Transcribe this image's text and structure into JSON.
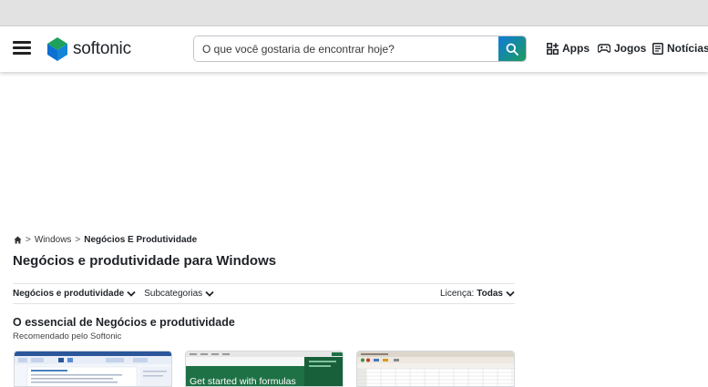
{
  "header": {
    "logo_text": "softonic",
    "search_placeholder": "O que você gostaria de encontrar hoje?",
    "nav": {
      "apps": "Apps",
      "games": "Jogos",
      "news": "Notícias"
    }
  },
  "breadcrumb": {
    "sep1": ">",
    "windows": "Windows",
    "sep2": ">",
    "current": "Negócios E Produtividade"
  },
  "page_title": "Negócios e produtividade para Windows",
  "filters": {
    "category": "Negócios e produtividade",
    "subcategories": "Subcategorias",
    "license_label": "Licença:",
    "license_value": "Todas"
  },
  "section": {
    "title": "O essencial de Negócios e produtividade",
    "subtitle": "Recomendado pelo Softonic"
  },
  "cards": {
    "card2_text": "Get started with formulas"
  },
  "colors": {
    "accent_green": "#1d9b5e",
    "accent_blue": "#0f7bd8",
    "excel_green": "#1e7145"
  }
}
